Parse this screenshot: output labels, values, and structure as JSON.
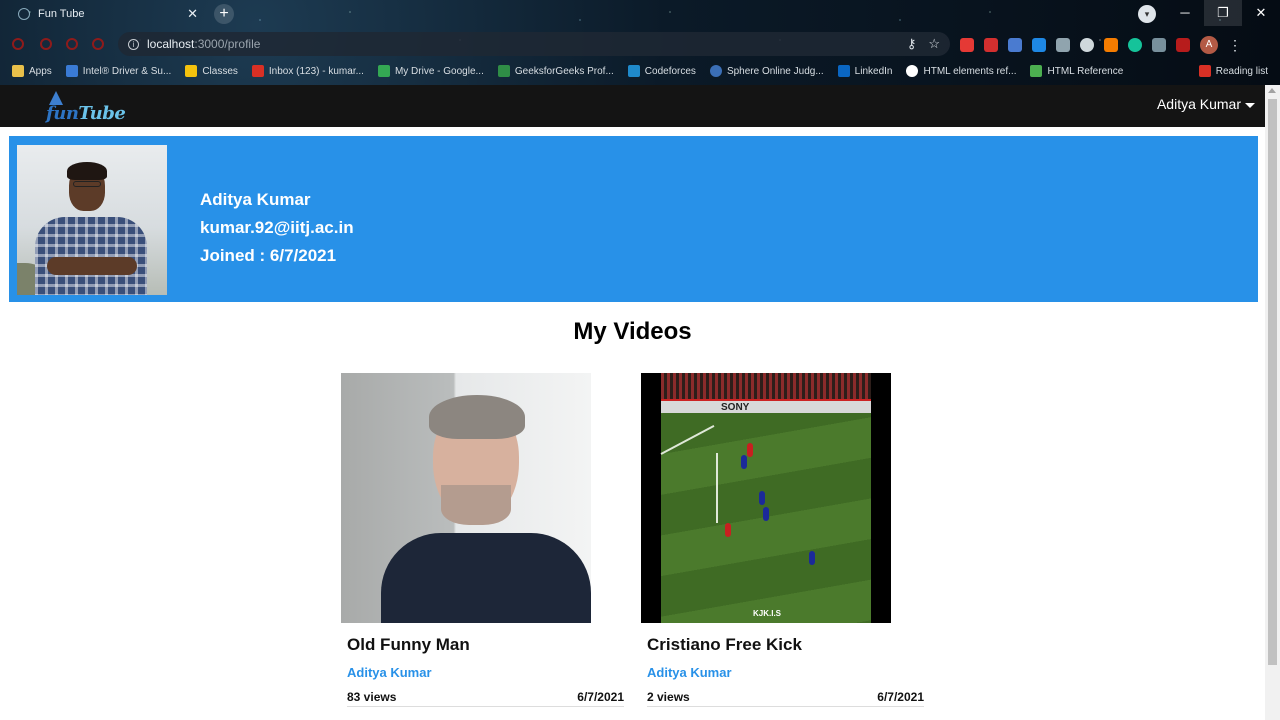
{
  "browser": {
    "tab_title": "Fun Tube",
    "tab_close": "✕",
    "new_tab": "+",
    "url_host": "localhost",
    "url_path": ":3000/profile",
    "window_controls": [
      "─",
      "❐",
      "✕"
    ],
    "profile_initial": "A",
    "bookmarks": [
      {
        "label": "Apps",
        "color": "#e8c04a"
      },
      {
        "label": "Intel® Driver & Su...",
        "color": "#3a7bd5"
      },
      {
        "label": "Classes",
        "color": "#f4c20d"
      },
      {
        "label": "Inbox (123) - kumar...",
        "color": "#d93025"
      },
      {
        "label": "My Drive - Google...",
        "color": "#34a853"
      },
      {
        "label": "GeeksforGeeks Prof...",
        "color": "#2f8d46"
      },
      {
        "label": "Codeforces",
        "color": "#1f8acb"
      },
      {
        "label": "Sphere Online Judg...",
        "color": "#3b6fb6"
      },
      {
        "label": "LinkedIn",
        "color": "#0a66c2"
      },
      {
        "label": "HTML elements ref...",
        "color": "#ffffff"
      },
      {
        "label": "HTML Reference",
        "color": "#4caf50"
      }
    ],
    "reading_list": "Reading list"
  },
  "site": {
    "logo_fun": "fun",
    "logo_tube": "Tube",
    "user_menu_label": "Aditya Kumar"
  },
  "profile": {
    "name": "Aditya Kumar",
    "email": "kumar.92@iitj.ac.in",
    "joined": "Joined : 6/7/2021"
  },
  "section_title": "My Videos",
  "videos": [
    {
      "title": "Old Funny Man",
      "author": "Aditya Kumar",
      "views": "83 views",
      "date": "6/7/2021"
    },
    {
      "title": "Cristiano Free Kick",
      "author": "Aditya Kumar",
      "views": "2 views",
      "date": "6/7/2021",
      "overlay_text": "SONY",
      "watermark": "KJK.I.S"
    }
  ],
  "colors": {
    "banner": "#2891e8",
    "navbar": "#141414",
    "author_link": "#2891e8"
  }
}
